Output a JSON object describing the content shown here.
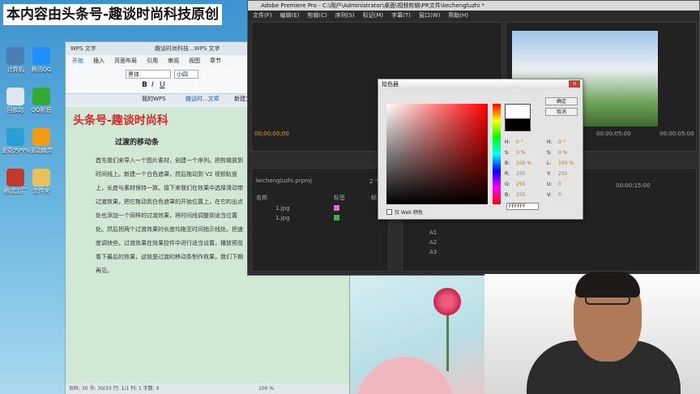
{
  "watermark": "本内容由头条号-趣谈时尚科技原创",
  "desktop_icons": [
    {
      "label": "计算机",
      "color": "#4a7fb3"
    },
    {
      "label": "腾讯QQ",
      "color": "#1e90ff"
    },
    {
      "label": "回收站",
      "color": "#dfe6ee"
    },
    {
      "label": "QQ影音",
      "color": "#3a3"
    },
    {
      "label": "爱奇艺PPS",
      "color": "#2a9fd6"
    },
    {
      "label": "驱动精灵",
      "color": "#f39c12"
    },
    {
      "label": "格式工厂",
      "color": "#c0392b"
    },
    {
      "label": "文件夹",
      "color": "#e8c15a"
    }
  ],
  "wps": {
    "tab_title": "WPS 文字",
    "doc_tab": "趣谈时尚科技...WPS 文字",
    "menus": [
      "开始",
      "插入",
      "页面布局",
      "引用",
      "审阅",
      "视图",
      "章节"
    ],
    "font": "黑体",
    "size": "小四",
    "doc_tabs": [
      "我的WPS",
      "趣谈时...文章",
      "新建文档"
    ],
    "title": "头条号-趣谈时尚科",
    "subtitle": "过渡的移动条",
    "para": "首先我们来导入一个图片素材，创建一个序列。把剪辑放到时间线上。新建一个白色遮罩，然后拖动到 V2 视频轨道上，长度与素材保持一致。接下来我们在效果中选择滑动带过渡效果，把它拖动到白色遮罩的开始位置上，在它的出点处也添加一个同样的过渡效果，将时间线调整到适当位置处。然后把两个过渡效果的长度均拖至时间指示线处。把速度调快些，过渡效果在效果控件中进行适当设置，播放预览看下最后的效果，这就是过渡的移动条制作效果，我们下期再见。",
    "status": "页码: 30  节: 30/33  行: 1/1  列: 1  字数: 0",
    "zoom": "100 %"
  },
  "premiere": {
    "title": "Adobe Premiere Pro - C:\\用户\\Administrator\\桌面\\视频剪辑\\PR文件\\kechengluzhi *",
    "menus": [
      "文件(F)",
      "编辑(E)",
      "剪辑(C)",
      "序列(S)",
      "标记(M)",
      "字幕(T)",
      "窗口(W)",
      "帮助(H)"
    ],
    "tc_left": "00;00;00;00",
    "tc_right": "00:00:05:00",
    "tc_right2": "00:00:05:00",
    "project": "kechengluzhi.prproj",
    "count": "2 个",
    "cols": [
      "名称",
      "标签",
      "帧"
    ],
    "items": [
      {
        "name": "1.jpg",
        "label_color": "#e06ad8"
      },
      {
        "name": "1.jpg",
        "label_color": "#3ab34a"
      }
    ],
    "tracks": [
      "A1",
      "A2",
      "A3"
    ],
    "timeline_tc": "00:00:15:00"
  },
  "picker": {
    "title": "拾色器",
    "ok": "确定",
    "cancel": "取消",
    "web_only": "仅 Web 颜色",
    "fields": [
      [
        "H:",
        "0 °",
        "H:",
        "0 °"
      ],
      [
        "S:",
        "0 %",
        "S:",
        "0 %"
      ],
      [
        "B:",
        "100 %",
        "L:",
        "100 %"
      ],
      [
        "R:",
        "255",
        "Y:",
        "255"
      ],
      [
        "G:",
        "255",
        "U:",
        "0"
      ],
      [
        "B:",
        "255",
        "V:",
        "0"
      ]
    ],
    "hex": "FFFFFF"
  }
}
